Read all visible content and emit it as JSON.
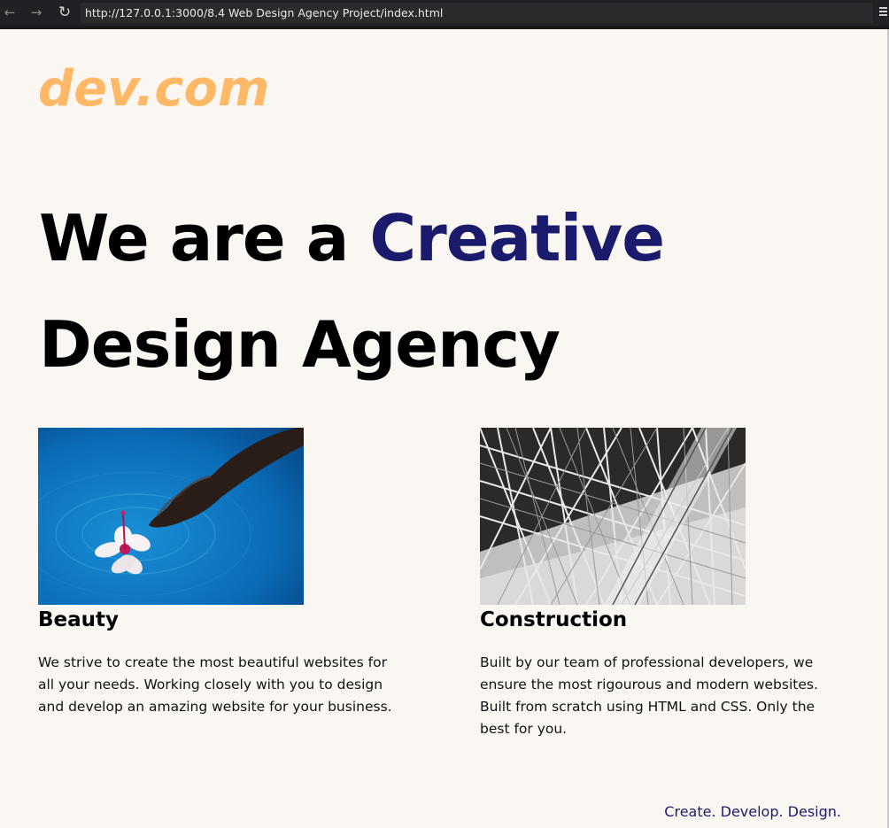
{
  "browser": {
    "back_icon": "←",
    "forward_icon": "→",
    "reload_icon": "↻",
    "url": "http://127.0.0.1:3000/8.4 Web Design Agency Project/index.html"
  },
  "colors": {
    "logo": "#ffb866",
    "accent": "#1b1b6e",
    "background": "#faf7f2"
  },
  "logo": "dev.com",
  "headline": {
    "part1": "We are a ",
    "accent": "Creative",
    "line2": "Design Agency"
  },
  "cards": [
    {
      "title": "Beauty",
      "image": "hand-touching-water-with-hibiscus-flower",
      "text": "We strive to create the most beautiful websites for all your needs. Working closely with you to design and develop an amazing website for your business."
    },
    {
      "title": "Construction",
      "image": "black-and-white-steel-structure",
      "text": "Built by our team of professional developers, we ensure the most rigourous and modern websites. Built from scratch using HTML and CSS. Only the best for you."
    }
  ],
  "footer": {
    "tagline": "Create. Develop. Design."
  }
}
